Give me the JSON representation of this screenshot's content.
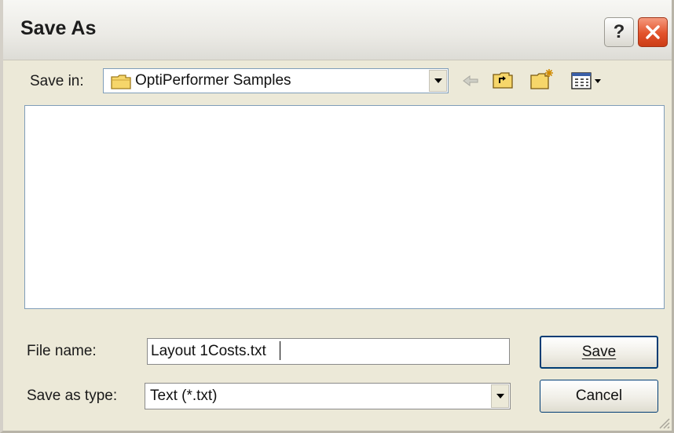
{
  "dialog": {
    "title": "Save As",
    "help_glyph": "?"
  },
  "toolbar": {
    "save_in_label": "Save in:",
    "save_in_mnemonic": "i",
    "location": "OptiPerformer Samples",
    "icons": [
      "folder-icon",
      "back-arrow-icon",
      "up-folder-icon",
      "new-folder-icon",
      "view-menu-icon"
    ]
  },
  "form": {
    "file_name_label": "File name:",
    "file_name_mnemonic": "n",
    "file_name_value": "Layout 1Costs.txt",
    "save_type_label": "Save as type:",
    "save_type_mnemonic": "t",
    "save_type_value": "Text (*.txt)"
  },
  "buttons": {
    "save": "Save",
    "save_mnemonic": "S",
    "cancel": "Cancel"
  },
  "colors": {
    "dialog_bg": "#ece9d8",
    "close_button": "#e2532b",
    "input_border": "#7f9db9",
    "default_button_border": "#003c74"
  }
}
